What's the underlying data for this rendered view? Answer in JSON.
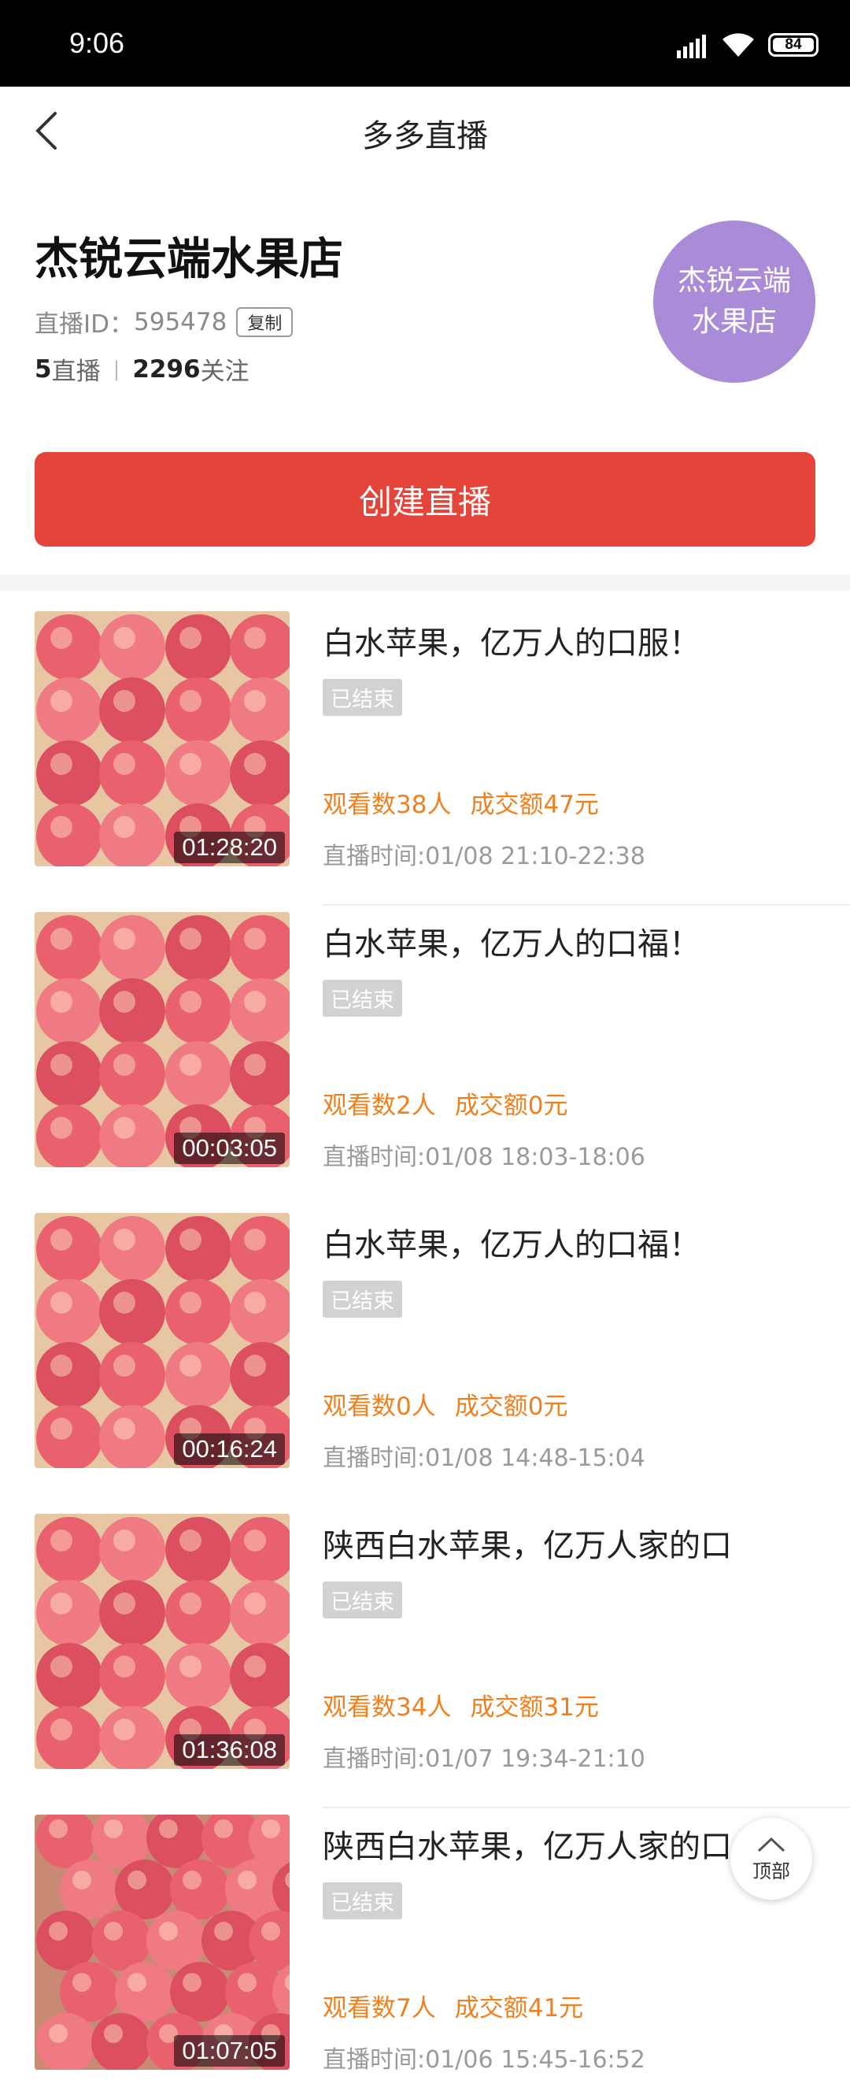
{
  "status": {
    "time": "9:06",
    "battery": "84"
  },
  "nav": {
    "title": "多多直播"
  },
  "shop": {
    "name": "杰锐云端水果店",
    "live_id_label": "直播ID：",
    "live_id": "595478",
    "copy": "复制",
    "lives_count": "5",
    "lives_label": "直播",
    "follow_count": "2296",
    "follow_label": "关注",
    "avatar_line1": "杰锐云端",
    "avatar_line2": "水果店"
  },
  "create_button": "创建直播",
  "items": [
    {
      "title": "白水苹果，亿万人的口服！",
      "status": "已结束",
      "viewers": "观看数38人",
      "sales": "成交额47元",
      "time": "直播时间:01/08 21:10-22:38",
      "duration": "01:28:20"
    },
    {
      "title": "白水苹果，亿万人的口福！",
      "status": "已结束",
      "viewers": "观看数2人",
      "sales": "成交额0元",
      "time": "直播时间:01/08 18:03-18:06",
      "duration": "00:03:05"
    },
    {
      "title": "白水苹果，亿万人的口福！",
      "status": "已结束",
      "viewers": "观看数0人",
      "sales": "成交额0元",
      "time": "直播时间:01/08 14:48-15:04",
      "duration": "00:16:24"
    },
    {
      "title": "陕西白水苹果，亿万人家的口",
      "status": "已结束",
      "viewers": "观看数34人",
      "sales": "成交额31元",
      "time": "直播时间:01/07 19:34-21:10",
      "duration": "01:36:08"
    },
    {
      "title": "陕西白水苹果，亿万人家的口",
      "status": "已结束",
      "viewers": "观看数7人",
      "sales": "成交额41元",
      "time": "直播时间:01/06 15:45-16:52",
      "duration": "01:07:05"
    }
  ],
  "to_top": "顶部",
  "colors": {
    "accent": "#e5443b",
    "metric": "#f0801d",
    "avatar": "#a98bd8"
  }
}
